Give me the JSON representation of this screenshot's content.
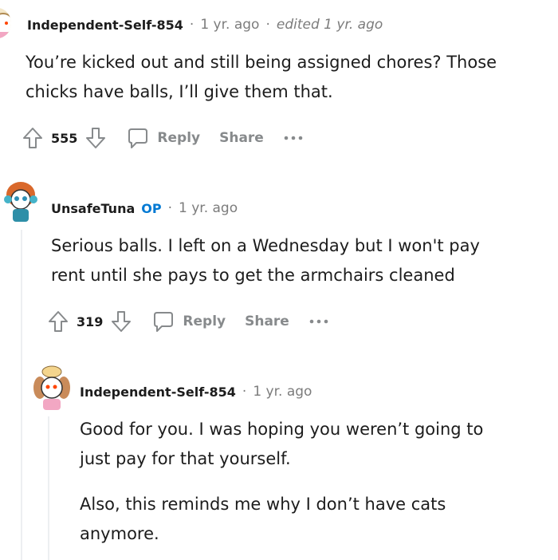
{
  "comments": [
    {
      "username": "Independent-Self-854",
      "separator": "·",
      "time": "1 yr. ago",
      "edited": "edited 1 yr. ago",
      "body": [
        "You’re kicked out and still being assigned chores? Those",
        "chicks have balls, I’ll give them that."
      ],
      "score": "555",
      "reply_label": "Reply",
      "share_label": "Share"
    },
    {
      "username": "UnsafeTuna",
      "op_badge": "OP",
      "separator": "·",
      "time": "1 yr. ago",
      "body": [
        "Serious balls. I left on a Wednesday but I won't pay",
        "rent until she pays to get the armchairs cleaned"
      ],
      "score": "319",
      "reply_label": "Reply",
      "share_label": "Share"
    },
    {
      "username": "Independent-Self-854",
      "separator": "·",
      "time": "1 yr. ago",
      "paragraph1": [
        "Good for you. I was hoping you weren’t going to",
        "just pay for that yourself."
      ],
      "paragraph2": [
        "Also, this reminds me why I don’t have cats",
        "anymore."
      ]
    }
  ],
  "icons": {
    "upvote": "upvote-arrow-icon",
    "downvote": "downvote-arrow-icon",
    "reply": "speech-bubble-icon",
    "more": "ellipsis-icon"
  },
  "colors": {
    "op_badge": "#0079d3",
    "action_gray": "#878a8c",
    "thread_line": "#edeff1"
  }
}
